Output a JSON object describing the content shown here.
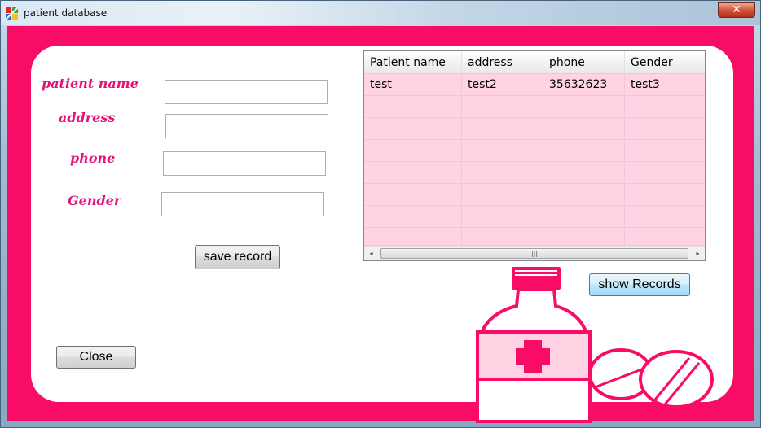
{
  "window": {
    "title": "patient database",
    "close_glyph": "✕"
  },
  "form": {
    "patient_name_label": "patient name",
    "address_label": "address",
    "phone_label": "phone",
    "gender_label": "Gender",
    "patient_name_value": "",
    "address_value": "",
    "phone_value": "",
    "gender_value": "",
    "save_label": "save record",
    "close_label": "Close"
  },
  "grid": {
    "columns": [
      "Patient name",
      "address",
      "phone",
      "Gender"
    ],
    "rows": [
      [
        "test",
        "test2",
        "35632623",
        "test3"
      ]
    ],
    "scroll_left_glyph": "◂",
    "scroll_right_glyph": "▸",
    "thumb_grip": "|||"
  },
  "show_records_label": "show Records",
  "icons": {
    "app": "app-color-icon",
    "decoration": "medicine-bottle-and-pills-icon"
  },
  "colors": {
    "background": "#f80c66",
    "label": "#e2147a",
    "grid_fill": "#ffd3e4"
  }
}
